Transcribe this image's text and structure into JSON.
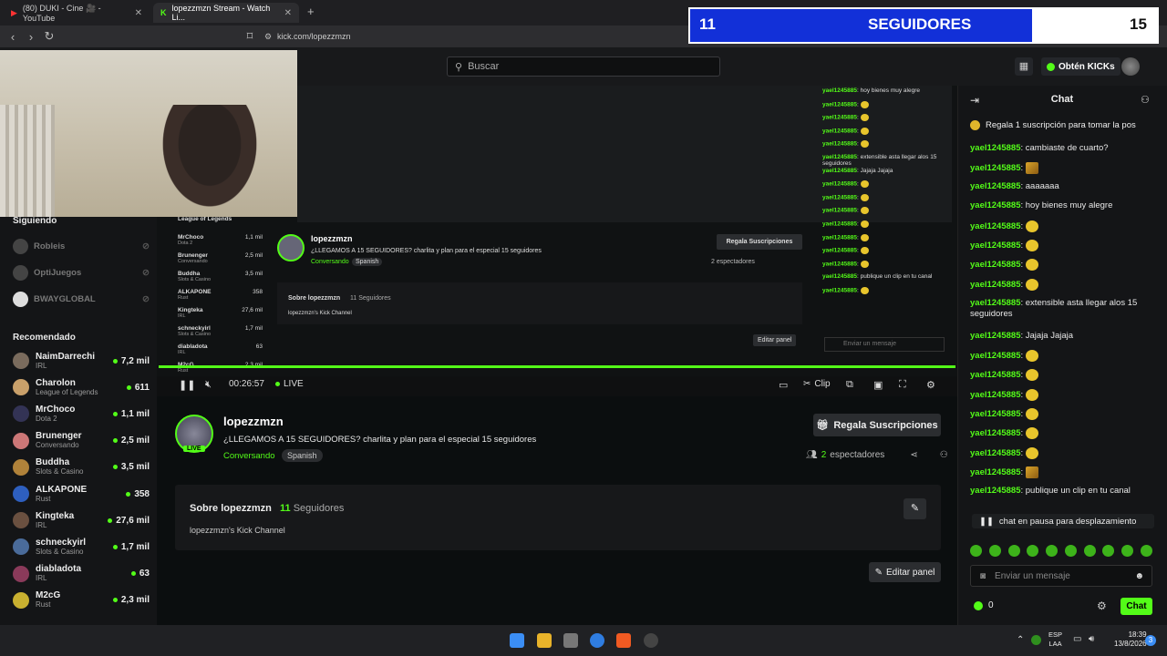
{
  "browser": {
    "tabs": [
      {
        "label": "(80) DUKI - Cine 🎥 - YouTube",
        "active": false
      },
      {
        "label": "lopezzmzn Stream - Watch Li...",
        "active": true
      }
    ],
    "url": "kick.com/lopezzmzn"
  },
  "follower_goal": {
    "current": "11",
    "label": "SEGUIDORES",
    "goal": "15",
    "fill_fraction": 0.733
  },
  "header": {
    "search_placeholder": "Buscar",
    "get_kicks": "Obtén KICKs"
  },
  "sidebar": {
    "following_title": "Siguiendo",
    "following": [
      {
        "name": "Robleis"
      },
      {
        "name": "OptiJuegos"
      },
      {
        "name": "BWAYGLOBAL"
      }
    ],
    "recommended_title": "Recomendado",
    "recommended": [
      {
        "name": "NaimDarrechi",
        "category": "IRL",
        "viewers": "7,2 mil"
      },
      {
        "name": "Charolon",
        "category": "League of Legends",
        "viewers": "611"
      },
      {
        "name": "MrChoco",
        "category": "Dota 2",
        "viewers": "1,1 mil"
      },
      {
        "name": "Brunenger",
        "category": "Conversando",
        "viewers": "2,5 mil"
      },
      {
        "name": "Buddha",
        "category": "Slots & Casino",
        "viewers": "3,5 mil"
      },
      {
        "name": "ALKAPONE",
        "category": "Rust",
        "viewers": "358"
      },
      {
        "name": "Kingteka",
        "category": "IRL",
        "viewers": "27,6 mil"
      },
      {
        "name": "schneckyirl",
        "category": "Slots & Casino",
        "viewers": "1,7 mil"
      },
      {
        "name": "diabladota",
        "category": "IRL",
        "viewers": "63"
      },
      {
        "name": "M2cG",
        "category": "Rust",
        "viewers": "2,3 mil"
      }
    ]
  },
  "player": {
    "time": "00:26:57",
    "live": "LIVE",
    "clip": "Clip"
  },
  "stream": {
    "name": "lopezzmzn",
    "live_badge": "LIVE",
    "title": "¿LLEGAMOS A 15 SEGUIDORES? charlita y plan para el especial 15 seguidores",
    "category": "Conversando",
    "tag": "Spanish",
    "subscribe": "Regala Suscripciones",
    "viewers_count": "2",
    "viewers_label": "espectadores"
  },
  "about": {
    "title": "Sobre lopezzmzn",
    "followers_count": "11",
    "followers_label": "Seguidores",
    "description": "lopezzmzn's Kick Channel",
    "edit_panel": "Editar panel"
  },
  "chat": {
    "title": "Chat",
    "gift_banner": "Regala 1 suscripción para tomar la pos",
    "messages": [
      {
        "user": "yael1245885",
        "text": "cambiaste de cuarto?"
      },
      {
        "user": "yael1245885",
        "text": "",
        "emote": "sq"
      },
      {
        "user": "yael1245885",
        "text": "aaaaaaa"
      },
      {
        "user": "yael1245885",
        "text": "hoy bienes muy alegre"
      },
      {
        "user": "yael1245885",
        "text": "",
        "emote": "round"
      },
      {
        "user": "yael1245885",
        "text": "",
        "emote": "round"
      },
      {
        "user": "yael1245885",
        "text": "",
        "emote": "round"
      },
      {
        "user": "yael1245885",
        "text": "",
        "emote": "round"
      },
      {
        "user": "yael1245885",
        "text": "extensible asta llegar alos 15 seguidores"
      },
      {
        "user": "yael1245885",
        "text": "Jajaja Jajaja"
      },
      {
        "user": "yael1245885",
        "text": "",
        "emote": "round"
      },
      {
        "user": "yael1245885",
        "text": "",
        "emote": "round"
      },
      {
        "user": "yael1245885",
        "text": "",
        "emote": "round"
      },
      {
        "user": "yael1245885",
        "text": "",
        "emote": "round"
      },
      {
        "user": "yael1245885",
        "text": "",
        "emote": "round"
      },
      {
        "user": "yael1245885",
        "text": "",
        "emote": "round"
      },
      {
        "user": "yael1245885",
        "text": "",
        "emote": "sq"
      },
      {
        "user": "yael1245885",
        "text": "publique un clip en tu canal"
      }
    ],
    "paused": "chat en pausa para desplazamiento",
    "input_placeholder": "Enviar un mensaje",
    "kicks": "0",
    "send": "Chat"
  },
  "taskbar": {
    "lang": "ESP",
    "lang2": "LAA",
    "time": "18:39",
    "date": "13/8/2026",
    "badge": "3"
  },
  "capture": {
    "name": "lopezzmzn",
    "title": "¿LLEGAMOS A 15 SEGUIDORES? charlita y plan para el especial 15 seguidores",
    "category": "Conversando",
    "tag": "Spanish",
    "subscribe": "Regala Suscripciones",
    "viewers": "2 espectadores",
    "about": "Sobre lopezzmzn",
    "about_followers": "11 Seguidores",
    "about_desc": "lopezzmzn's Kick Channel",
    "edit_panel": "Editar panel",
    "input": "Enviar un mensaje",
    "sidebar": [
      {
        "name": "League of Legends",
        "viewers": ""
      },
      {
        "name": "MrChoco",
        "sub": "Dota 2",
        "viewers": "1,1 mil"
      },
      {
        "name": "Brunenger",
        "sub": "Conversando",
        "viewers": "2,5 mil"
      },
      {
        "name": "Buddha",
        "sub": "Slots & Casino",
        "viewers": "3,5 mil"
      },
      {
        "name": "ALKAPONE",
        "sub": "Rust",
        "viewers": "358"
      },
      {
        "name": "Kingteka",
        "sub": "IRL",
        "viewers": "27,6 mil"
      },
      {
        "name": "schneckyirl",
        "sub": "Slots & Casino",
        "viewers": "1,7 mil"
      },
      {
        "name": "diabladota",
        "sub": "IRL",
        "viewers": "63"
      },
      {
        "name": "M2cG",
        "sub": "Rust",
        "viewers": "2,3 mil"
      }
    ],
    "chat": [
      {
        "user": "yael1245885",
        "text": "hoy bienes muy alegre"
      },
      {
        "user": "yael1245885",
        "text": ""
      },
      {
        "user": "yael1245885",
        "text": ""
      },
      {
        "user": "yael1245885",
        "text": ""
      },
      {
        "user": "yael1245885",
        "text": ""
      },
      {
        "user": "yael1245885",
        "text": "extensible asta llegar alos 15 seguidores"
      },
      {
        "user": "yael1245885",
        "text": "Jajaja Jajaja"
      },
      {
        "user": "yael1245885",
        "text": ""
      },
      {
        "user": "yael1245885",
        "text": ""
      },
      {
        "user": "yael1245885",
        "text": ""
      },
      {
        "user": "yael1245885",
        "text": ""
      },
      {
        "user": "yael1245885",
        "text": ""
      },
      {
        "user": "yael1245885",
        "text": ""
      },
      {
        "user": "yael1245885",
        "text": ""
      },
      {
        "user": "yael1245885",
        "text": "publique un clip en tu canal"
      },
      {
        "user": "yael1245885",
        "text": ""
      }
    ]
  },
  "colors": {
    "accent": "#53fc18",
    "goal_fill": "#1230d8"
  }
}
